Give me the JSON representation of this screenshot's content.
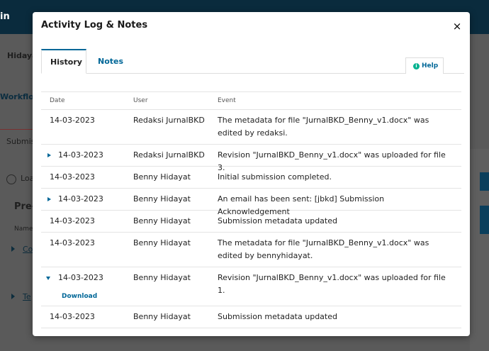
{
  "background": {
    "topbar_text": "in",
    "user_name": "Hidaya",
    "tab_workflow": "Workflow",
    "tab_submission": "Submis",
    "load_text": "Loa",
    "section_title": "Pre-",
    "col_name": "Name",
    "link_1": "Co",
    "link_2": "Te"
  },
  "modal": {
    "title": "Activity Log & Notes",
    "close_label": "×",
    "tabs": [
      {
        "label": "History",
        "active": true
      },
      {
        "label": "Notes",
        "active": false
      }
    ],
    "help_label": "Help",
    "help_icon_glyph": "i",
    "table": {
      "headers": {
        "date": "Date",
        "user": "User",
        "event": "Event"
      },
      "rows": [
        {
          "date": "14-03-2023",
          "user": "Redaksi JurnalBKD",
          "event": "The metadata for file \"JurnalBKD_Benny_v1.docx\" was edited by redaksi.",
          "expandable": false
        },
        {
          "date": "14-03-2023",
          "user": "Redaksi JurnalBKD",
          "event": "Revision \"JurnalBKD_Benny_v1.docx\" was uploaded for file 3.",
          "expandable": true
        },
        {
          "date": "14-03-2023",
          "user": "Benny Hidayat",
          "event": "Initial submission completed.",
          "expandable": false
        },
        {
          "date": "14-03-2023",
          "user": "Benny Hidayat",
          "event": "An email has been sent: [jbkd] Submission Acknowledgement",
          "expandable": true
        },
        {
          "date": "14-03-2023",
          "user": "Benny Hidayat",
          "event": "Submission metadata updated",
          "expandable": false
        },
        {
          "date": "14-03-2023",
          "user": "Benny Hidayat",
          "event": "The metadata for file \"JurnalBKD_Benny_v1.docx\" was edited by bennyhidayat.",
          "expandable": false
        },
        {
          "date": "14-03-2023",
          "user": "Benny Hidayat",
          "event": "Revision \"JurnalBKD_Benny_v1.docx\" was uploaded for file 1.",
          "expandable": true,
          "expanded": true,
          "download_label": "Download"
        },
        {
          "date": "14-03-2023",
          "user": "Benny Hidayat",
          "event": "Submission metadata updated",
          "expandable": false
        }
      ]
    }
  },
  "colors": {
    "accent": "#006798",
    "help_icon": "#00b28f",
    "topbar": "#0a2b3d"
  }
}
